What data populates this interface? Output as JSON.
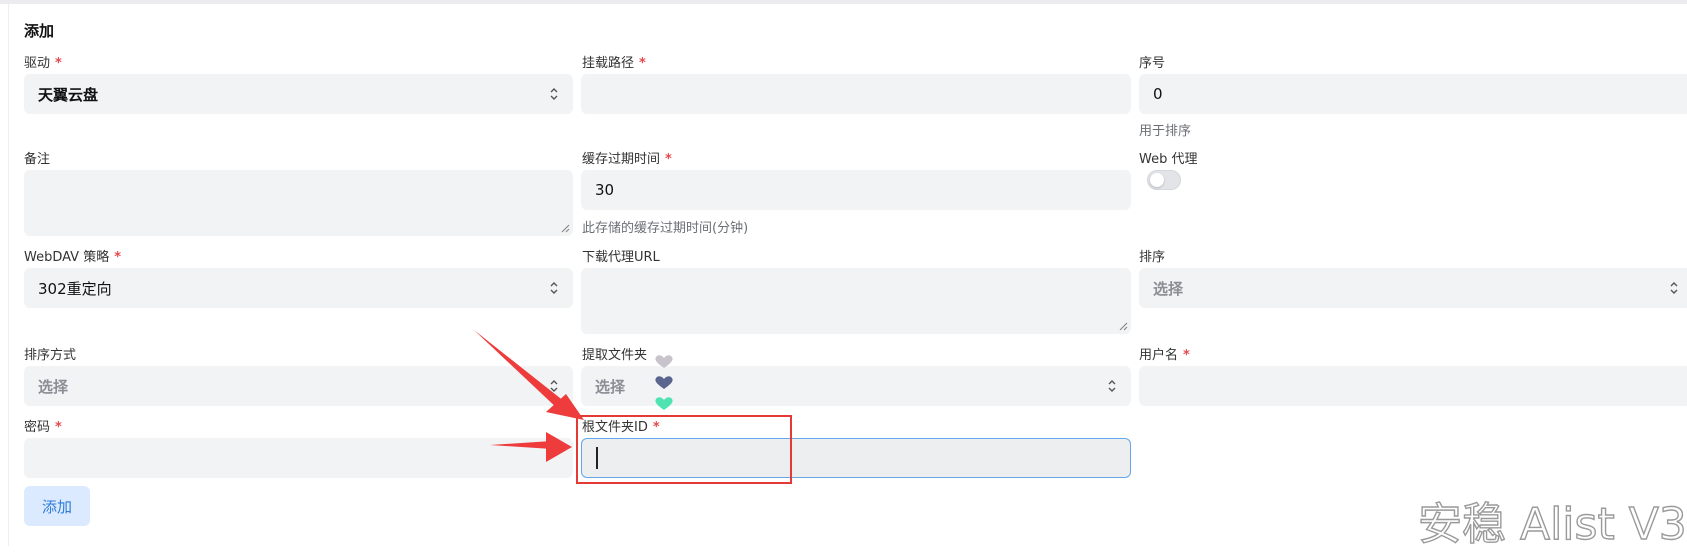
{
  "form": {
    "title": "添加",
    "required_mark": "*",
    "fields": {
      "driver": {
        "label": "驱动",
        "value": "天翼云盘"
      },
      "mount_path": {
        "label": "挂载路径",
        "value": ""
      },
      "order": {
        "label": "序号",
        "value": "0",
        "help": "用于排序"
      },
      "remark": {
        "label": "备注",
        "value": ""
      },
      "cache_expiration": {
        "label": "缓存过期时间",
        "value": "30",
        "help": "此存储的缓存过期时间(分钟)"
      },
      "web_proxy": {
        "label": "Web 代理",
        "checked": false
      },
      "webdav_policy": {
        "label": "WebDAV 策略",
        "value": "302重定向"
      },
      "download_proxy_url": {
        "label": "下载代理URL",
        "value": ""
      },
      "order_by": {
        "label": "排序",
        "placeholder": "选择"
      },
      "order_direction": {
        "label": "排序方式",
        "placeholder": "选择"
      },
      "extract_folder": {
        "label": "提取文件夹",
        "placeholder": "选择"
      },
      "username": {
        "label": "用户名",
        "value": ""
      },
      "password": {
        "label": "密码",
        "value": ""
      },
      "root_folder_id": {
        "label": "根文件夹ID",
        "value": ""
      }
    },
    "submit_label": "添加"
  },
  "watermark": "安稳 Alist V3",
  "colors": {
    "required": "#e5484d",
    "button_bg": "#dbeafe",
    "button_text": "#2f7bd8",
    "field_bg": "#f1f3f5",
    "focus_border": "#63a7e8",
    "annotation_red": "#e53935"
  }
}
